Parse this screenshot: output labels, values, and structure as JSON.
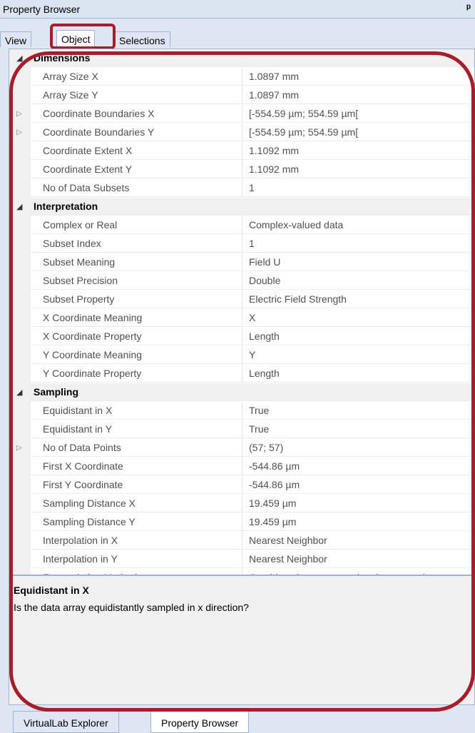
{
  "titlebar": {
    "title": "Property Browser",
    "pin_glyph": "ᵖ"
  },
  "tabs": [
    {
      "label": "View"
    },
    {
      "label": "Object"
    },
    {
      "label": "Selections"
    }
  ],
  "rows": [
    {
      "type": "cat",
      "label": "Dimensions"
    },
    {
      "label": "Array Size X",
      "value": "1.0897 mm"
    },
    {
      "label": "Array Size Y",
      "value": "1.0897 mm"
    },
    {
      "label": "Coordinate Boundaries X",
      "value": "[-554.59 µm; 554.59 µm[",
      "expandable": true
    },
    {
      "label": "Coordinate Boundaries Y",
      "value": "[-554.59 µm; 554.59 µm[",
      "expandable": true
    },
    {
      "label": "Coordinate Extent X",
      "value": "1.1092 mm"
    },
    {
      "label": "Coordinate Extent Y",
      "value": "1.1092 mm"
    },
    {
      "label": "No of Data Subsets",
      "value": "1"
    },
    {
      "type": "cat",
      "label": "Interpretation"
    },
    {
      "label": "Complex or Real",
      "value": "Complex-valued data"
    },
    {
      "label": "Subset Index",
      "value": "1"
    },
    {
      "label": "Subset Meaning",
      "value": "Field U"
    },
    {
      "label": "Subset Precision",
      "value": "Double"
    },
    {
      "label": "Subset Property",
      "value": "Electric Field Strength"
    },
    {
      "label": "X Coordinate Meaning",
      "value": "X"
    },
    {
      "label": "X Coordinate Property",
      "value": "Length"
    },
    {
      "label": "Y Coordinate Meaning",
      "value": "Y"
    },
    {
      "label": "Y Coordinate Property",
      "value": "Length"
    },
    {
      "type": "cat",
      "label": "Sampling"
    },
    {
      "label": "Equidistant in X",
      "value": "True"
    },
    {
      "label": "Equidistant in Y",
      "value": "True"
    },
    {
      "label": "No of Data Points",
      "value": "(57; 57)",
      "expandable": true
    },
    {
      "label": "First X Coordinate",
      "value": "-544.86 µm"
    },
    {
      "label": "First Y Coordinate",
      "value": "-544.86 µm"
    },
    {
      "label": "Sampling Distance X",
      "value": "19.459 µm"
    },
    {
      "label": "Sampling Distance Y",
      "value": "19.459 µm"
    },
    {
      "label": "Interpolation in X",
      "value": "Nearest Neighbor"
    },
    {
      "label": "Interpolation in Y",
      "value": "Nearest Neighbor"
    },
    {
      "label": "Extrapolation Method",
      "value": "Outside values are equal to the respective n"
    }
  ],
  "description": {
    "title": "Equidistant in X",
    "text": "Is the data array equidistantly sampled in x direction?"
  },
  "bottom_tabs": [
    {
      "label": "VirtualLab Explorer"
    },
    {
      "label": "Property Browser"
    }
  ],
  "colors": {
    "highlight": "#a61e2b",
    "category_bg": "#f0f0f0"
  },
  "icons": {
    "category_arrow": "collapse-triangle-icon",
    "expander": "expand-triangle-icon"
  }
}
